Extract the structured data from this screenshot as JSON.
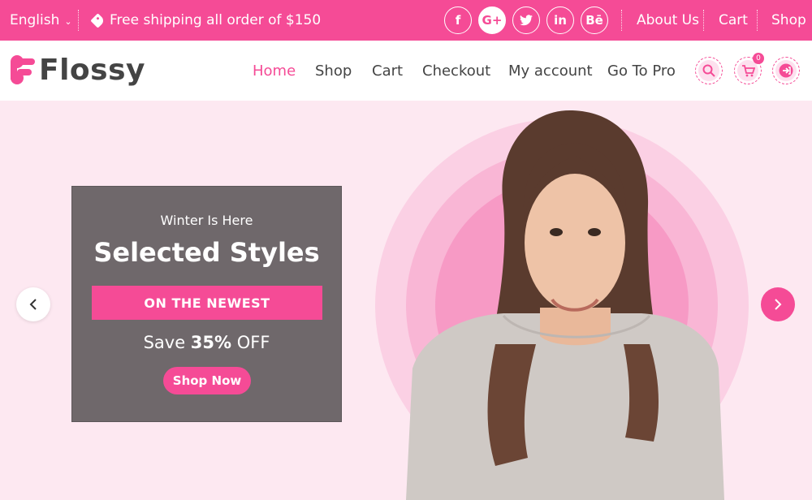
{
  "topbar": {
    "language": "English",
    "shipping_text": "Free shipping all order of $150",
    "socials": [
      {
        "icon": "facebook-icon",
        "glyph": "f"
      },
      {
        "icon": "google-plus-icon",
        "glyph": "G+"
      },
      {
        "icon": "twitter-icon",
        "glyph": "t"
      },
      {
        "icon": "linkedin-icon",
        "glyph": "in"
      },
      {
        "icon": "behance-icon",
        "glyph": "Bē"
      }
    ],
    "links": [
      "About Us",
      "Cart",
      "Shop"
    ]
  },
  "header": {
    "logo_text": "Flossy",
    "nav": [
      "Home",
      "Shop",
      "Cart",
      "Checkout",
      "My account",
      "Go To Pro"
    ],
    "active_nav": "Home",
    "cart_count": "0"
  },
  "hero": {
    "eyebrow": "Winter Is Here",
    "title": "Selected Styles",
    "banner": "ON THE NEWEST",
    "save_prefix": "Save",
    "save_amount": "35%",
    "save_suffix": "OFF",
    "cta": "Shop Now"
  },
  "colors": {
    "accent": "#f54b96",
    "hero_bg": "#fde8f1",
    "promo_bg": "#6f686b"
  }
}
